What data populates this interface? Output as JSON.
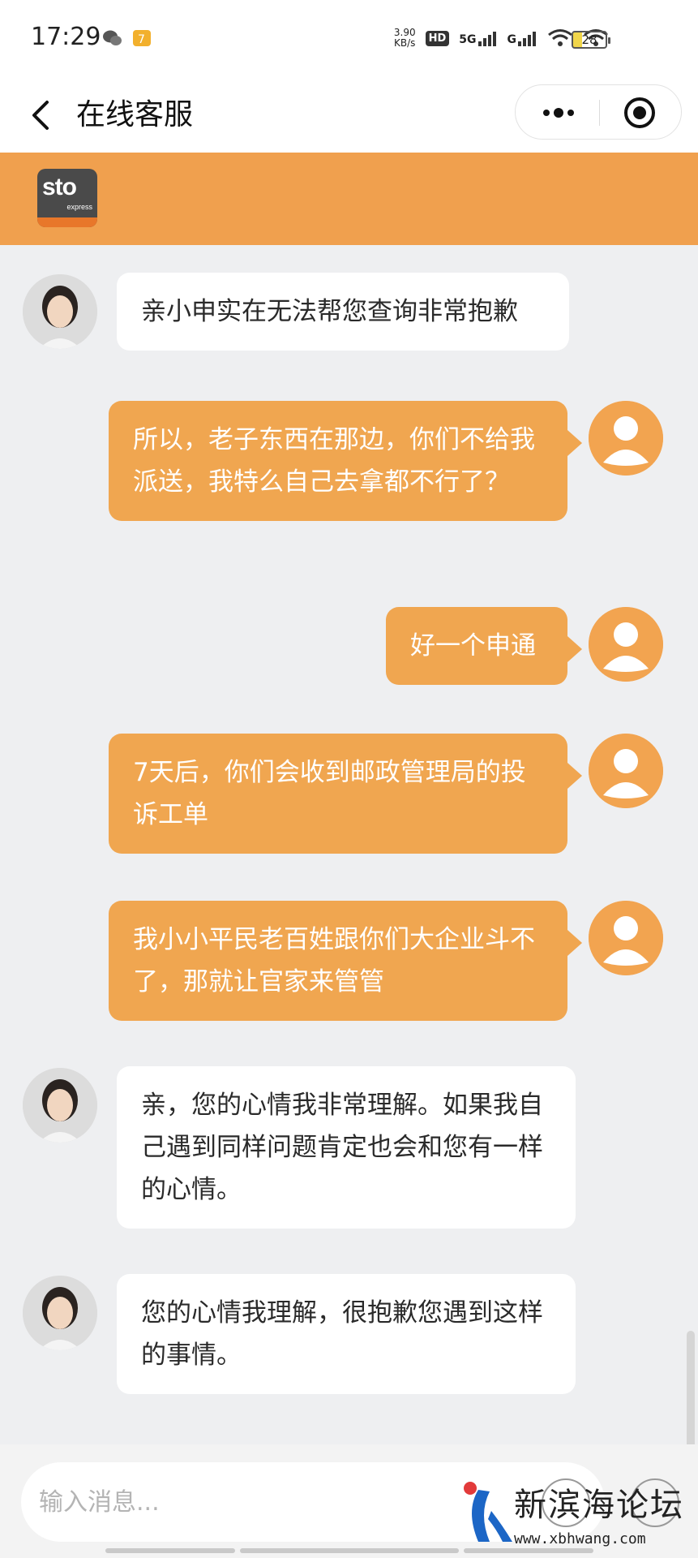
{
  "status_bar": {
    "time": "17:29",
    "net_speed": "3.90\nKB/s",
    "hd_label": "HD",
    "sim1_label": "5G",
    "sim2_label": "G",
    "battery": "28"
  },
  "nav": {
    "title": "在线客服",
    "back_icon": "chevron-left-icon",
    "more_icon": "more-dots-icon",
    "close_icon": "target-close-icon"
  },
  "brand": {
    "logo_text": "sto",
    "logo_sub": "express",
    "brand_color": "#f0a04e"
  },
  "messages": [
    {
      "sender": "agent",
      "text": "亲小申实在无法帮您查询非常抱歉"
    },
    {
      "sender": "user",
      "text": "所以，老子东西在那边，你们不给我派送，我特么自己去拿都不行了？"
    },
    {
      "sender": "user",
      "text": "好一个申通"
    },
    {
      "sender": "user",
      "text": "7天后，你们会收到邮政管理局的投诉工单"
    },
    {
      "sender": "user",
      "text": "我小小平民老百姓跟你们大企业斗不了，那就让官家来管管"
    },
    {
      "sender": "agent",
      "text": "亲，您的心情我非常理解。如果我自己遇到同样问题肯定也会和您有一样的心情。"
    },
    {
      "sender": "agent",
      "text": "您的心情我理解，很抱歉您遇到这样的事情。"
    }
  ],
  "input": {
    "placeholder": "输入消息..."
  },
  "watermark": {
    "title": "新滨海论坛",
    "url": "www.xbhwang.com"
  },
  "colors": {
    "user_bubble": "#f0a650",
    "agent_bubble": "#ffffff",
    "background": "#eeeff1"
  }
}
